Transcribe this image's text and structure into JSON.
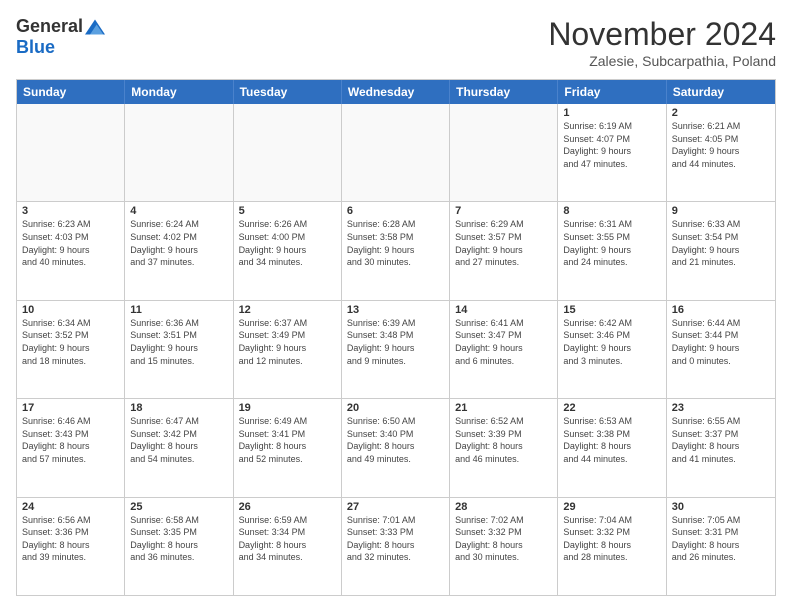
{
  "header": {
    "logo": {
      "general": "General",
      "blue": "Blue"
    },
    "title": "November 2024",
    "subtitle": "Zalesie, Subcarpathia, Poland"
  },
  "calendar": {
    "weekdays": [
      "Sunday",
      "Monday",
      "Tuesday",
      "Wednesday",
      "Thursday",
      "Friday",
      "Saturday"
    ],
    "rows": [
      [
        {
          "day": "",
          "info": "",
          "empty": true
        },
        {
          "day": "",
          "info": "",
          "empty": true
        },
        {
          "day": "",
          "info": "",
          "empty": true
        },
        {
          "day": "",
          "info": "",
          "empty": true
        },
        {
          "day": "",
          "info": "",
          "empty": true
        },
        {
          "day": "1",
          "info": "Sunrise: 6:19 AM\nSunset: 4:07 PM\nDaylight: 9 hours\nand 47 minutes.",
          "empty": false
        },
        {
          "day": "2",
          "info": "Sunrise: 6:21 AM\nSunset: 4:05 PM\nDaylight: 9 hours\nand 44 minutes.",
          "empty": false
        }
      ],
      [
        {
          "day": "3",
          "info": "Sunrise: 6:23 AM\nSunset: 4:03 PM\nDaylight: 9 hours\nand 40 minutes.",
          "empty": false
        },
        {
          "day": "4",
          "info": "Sunrise: 6:24 AM\nSunset: 4:02 PM\nDaylight: 9 hours\nand 37 minutes.",
          "empty": false
        },
        {
          "day": "5",
          "info": "Sunrise: 6:26 AM\nSunset: 4:00 PM\nDaylight: 9 hours\nand 34 minutes.",
          "empty": false
        },
        {
          "day": "6",
          "info": "Sunrise: 6:28 AM\nSunset: 3:58 PM\nDaylight: 9 hours\nand 30 minutes.",
          "empty": false
        },
        {
          "day": "7",
          "info": "Sunrise: 6:29 AM\nSunset: 3:57 PM\nDaylight: 9 hours\nand 27 minutes.",
          "empty": false
        },
        {
          "day": "8",
          "info": "Sunrise: 6:31 AM\nSunset: 3:55 PM\nDaylight: 9 hours\nand 24 minutes.",
          "empty": false
        },
        {
          "day": "9",
          "info": "Sunrise: 6:33 AM\nSunset: 3:54 PM\nDaylight: 9 hours\nand 21 minutes.",
          "empty": false
        }
      ],
      [
        {
          "day": "10",
          "info": "Sunrise: 6:34 AM\nSunset: 3:52 PM\nDaylight: 9 hours\nand 18 minutes.",
          "empty": false
        },
        {
          "day": "11",
          "info": "Sunrise: 6:36 AM\nSunset: 3:51 PM\nDaylight: 9 hours\nand 15 minutes.",
          "empty": false
        },
        {
          "day": "12",
          "info": "Sunrise: 6:37 AM\nSunset: 3:49 PM\nDaylight: 9 hours\nand 12 minutes.",
          "empty": false
        },
        {
          "day": "13",
          "info": "Sunrise: 6:39 AM\nSunset: 3:48 PM\nDaylight: 9 hours\nand 9 minutes.",
          "empty": false
        },
        {
          "day": "14",
          "info": "Sunrise: 6:41 AM\nSunset: 3:47 PM\nDaylight: 9 hours\nand 6 minutes.",
          "empty": false
        },
        {
          "day": "15",
          "info": "Sunrise: 6:42 AM\nSunset: 3:46 PM\nDaylight: 9 hours\nand 3 minutes.",
          "empty": false
        },
        {
          "day": "16",
          "info": "Sunrise: 6:44 AM\nSunset: 3:44 PM\nDaylight: 9 hours\nand 0 minutes.",
          "empty": false
        }
      ],
      [
        {
          "day": "17",
          "info": "Sunrise: 6:46 AM\nSunset: 3:43 PM\nDaylight: 8 hours\nand 57 minutes.",
          "empty": false
        },
        {
          "day": "18",
          "info": "Sunrise: 6:47 AM\nSunset: 3:42 PM\nDaylight: 8 hours\nand 54 minutes.",
          "empty": false
        },
        {
          "day": "19",
          "info": "Sunrise: 6:49 AM\nSunset: 3:41 PM\nDaylight: 8 hours\nand 52 minutes.",
          "empty": false
        },
        {
          "day": "20",
          "info": "Sunrise: 6:50 AM\nSunset: 3:40 PM\nDaylight: 8 hours\nand 49 minutes.",
          "empty": false
        },
        {
          "day": "21",
          "info": "Sunrise: 6:52 AM\nSunset: 3:39 PM\nDaylight: 8 hours\nand 46 minutes.",
          "empty": false
        },
        {
          "day": "22",
          "info": "Sunrise: 6:53 AM\nSunset: 3:38 PM\nDaylight: 8 hours\nand 44 minutes.",
          "empty": false
        },
        {
          "day": "23",
          "info": "Sunrise: 6:55 AM\nSunset: 3:37 PM\nDaylight: 8 hours\nand 41 minutes.",
          "empty": false
        }
      ],
      [
        {
          "day": "24",
          "info": "Sunrise: 6:56 AM\nSunset: 3:36 PM\nDaylight: 8 hours\nand 39 minutes.",
          "empty": false
        },
        {
          "day": "25",
          "info": "Sunrise: 6:58 AM\nSunset: 3:35 PM\nDaylight: 8 hours\nand 36 minutes.",
          "empty": false
        },
        {
          "day": "26",
          "info": "Sunrise: 6:59 AM\nSunset: 3:34 PM\nDaylight: 8 hours\nand 34 minutes.",
          "empty": false
        },
        {
          "day": "27",
          "info": "Sunrise: 7:01 AM\nSunset: 3:33 PM\nDaylight: 8 hours\nand 32 minutes.",
          "empty": false
        },
        {
          "day": "28",
          "info": "Sunrise: 7:02 AM\nSunset: 3:32 PM\nDaylight: 8 hours\nand 30 minutes.",
          "empty": false
        },
        {
          "day": "29",
          "info": "Sunrise: 7:04 AM\nSunset: 3:32 PM\nDaylight: 8 hours\nand 28 minutes.",
          "empty": false
        },
        {
          "day": "30",
          "info": "Sunrise: 7:05 AM\nSunset: 3:31 PM\nDaylight: 8 hours\nand 26 minutes.",
          "empty": false
        }
      ]
    ]
  }
}
